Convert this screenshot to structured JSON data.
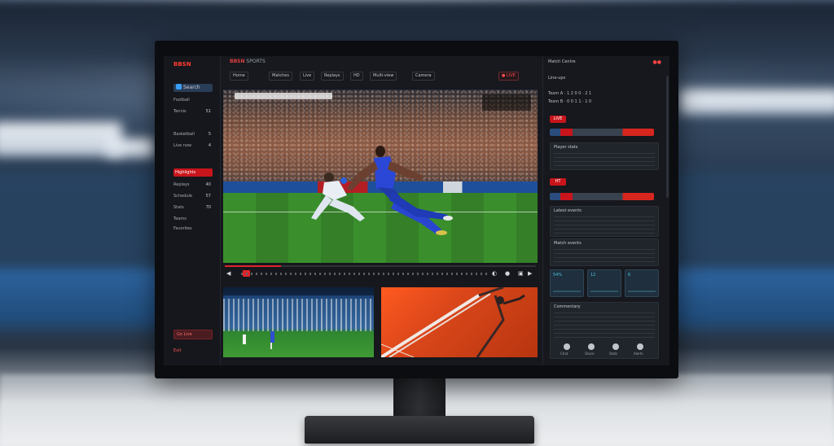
{
  "app": {
    "logo": "BBSN",
    "title_prefix": "BBSN",
    "title_rest": "SPORTS"
  },
  "sidebar": {
    "search_label": "Search",
    "items": [
      {
        "label": "Football",
        "count": ""
      },
      {
        "label": "Tennis",
        "count": "51"
      },
      {
        "label": "Basketball",
        "count": "5"
      },
      {
        "label": "Live now",
        "count": "4"
      },
      {
        "label": "Highlights",
        "count": "",
        "active": true
      },
      {
        "label": "Replays",
        "count": "40"
      },
      {
        "label": "Schedule",
        "count": "57"
      },
      {
        "label": "Stats",
        "count": "70"
      },
      {
        "label": "Teams",
        "count": ""
      },
      {
        "label": "Favorites",
        "count": ""
      }
    ],
    "bottom_button": "Go Live",
    "bottom_small": "Exit"
  },
  "topbar": {
    "chips": [
      "Home",
      "Matches",
      "Live",
      "Replays",
      "HD",
      "Multi-view",
      "Camera"
    ],
    "live_chip": "● LIVE"
  },
  "player": {
    "progress": 0.18,
    "controls": [
      "play-icon",
      "skip-back-icon",
      "skip-forward-icon",
      "volume-icon",
      "settings-icon",
      "fullscreen-icon"
    ]
  },
  "right_panel": {
    "header": "Match Centre",
    "sub": "Line-ups",
    "rows": [
      "Team A · 1 2 0 0 · 2 1",
      "Team B · 0 0 1 1 · 1 0"
    ],
    "tag1": "LIVE",
    "tag2": "HT",
    "card1_title": "Player stats",
    "card2_title": "Latest events",
    "card3_title": "Match events",
    "card4_title": "Commentary",
    "stats": [
      "54%",
      "12",
      "6"
    ],
    "bottom_icons": [
      "Chat",
      "Share",
      "Stats",
      "Alerts"
    ]
  }
}
